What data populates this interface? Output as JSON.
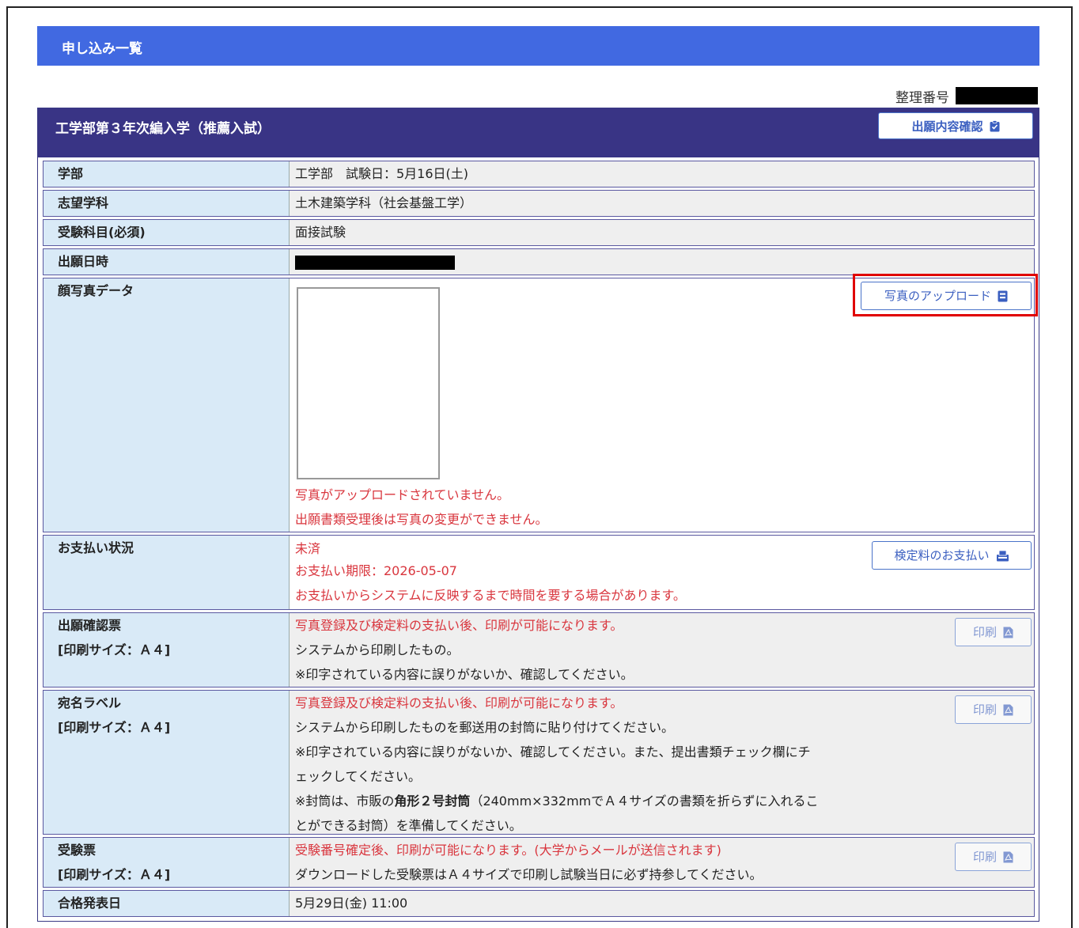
{
  "header": {
    "title": "申し込み一覧"
  },
  "reference": {
    "label": "整理番号"
  },
  "card": {
    "title": "工学部第３年次編入学（推薦入試）",
    "confirm_button": "出願内容確認"
  },
  "rows": {
    "faculty": {
      "label": "学部",
      "value": "工学部　試験日：5月16日(土)"
    },
    "department": {
      "label": "志望学科",
      "value": "土木建築学科（社会基盤工学）"
    },
    "subjects": {
      "label": "受験科目(必須)",
      "value": "面接試験"
    },
    "applied_at": {
      "label": "出願日時"
    },
    "photo": {
      "label": "顔写真データ",
      "upload_button": "写真のアップロード",
      "msg1": "写真がアップロードされていません。",
      "msg2": "出願書類受理後は写真の変更ができません。"
    },
    "payment": {
      "label": "お支払い状況",
      "status": "未済",
      "deadline": "お支払い期限：2026-05-07",
      "note": "お支払いからシステムに反映するまで時間を要する場合があります。",
      "pay_button": "検定料のお支払い"
    },
    "confirmation_slip": {
      "label1": "出願確認票",
      "label2": "[印刷サイズ：Ａ４]",
      "line1": "写真登録及び検定料の支払い後、印刷が可能になります。",
      "line2": "システムから印刷したもの。",
      "line3": "※印字されている内容に誤りがないか、確認してください。",
      "print_button": "印刷"
    },
    "address_label": {
      "label1": "宛名ラベル",
      "label2": "[印刷サイズ：Ａ４]",
      "line1": "写真登録及び検定料の支払い後、印刷が可能になります。",
      "line2": "システムから印刷したものを郵送用の封筒に貼り付けてください。",
      "line3a": "※印字されている内容に誤りがないか、確認してください。また、提出書類チェック欄にチ",
      "line3b": "ェックしてください。",
      "line4_pre": "※封筒は、市販の",
      "line4_bold": "角形２号封筒",
      "line4_post": "（240mm×332mmでＡ４サイズの書類を折らずに入れるこ",
      "line4b": "とができる封筒）を準備してください。",
      "print_button": "印刷"
    },
    "exam_ticket": {
      "label1": "受験票",
      "label2": "[印刷サイズ：Ａ４]",
      "line1": "受験番号確定後、印刷が可能になります。(大学からメールが送信されます)",
      "line2": "ダウンロードした受験票はＡ４サイズで印刷し試験当日に必ず持参してください。",
      "print_button": "印刷"
    },
    "result_date": {
      "label": "合格発表日",
      "value": "5月29日(金) 11:00"
    }
  },
  "colors": {
    "header_blue": "#4169e1",
    "card_head": "#393485",
    "label_bg": "#d9eaf7",
    "warning_red": "#d9363e",
    "highlight": "#e00000"
  },
  "icons": [
    "clipboard-check-icon",
    "id-badge-icon",
    "payment-icon",
    "pdf-icon"
  ]
}
